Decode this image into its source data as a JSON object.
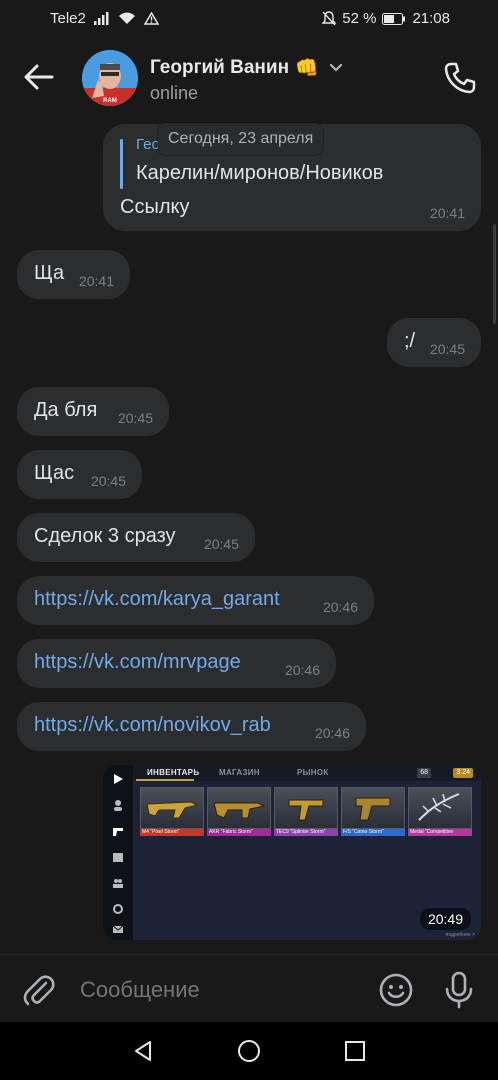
{
  "status_bar": {
    "carrier": "Tele2",
    "battery_percent": "52 %",
    "time": "21:08",
    "icons": [
      "signal-icon",
      "wifi-icon",
      "warning-icon",
      "mute-icon",
      "battery-icon"
    ]
  },
  "header": {
    "name": "Георгий Ванин",
    "emoji": "👊",
    "status": "online",
    "icons": [
      "back-arrow-icon",
      "chevron-down-icon",
      "phone-icon"
    ]
  },
  "date_divider": "Сегодня, 23 апреля",
  "reply_message": {
    "author": "Геор",
    "quoted_text": "Карелин/миронов/Новиков",
    "text": "Ссылку",
    "time": "20:41"
  },
  "messages": [
    {
      "side": "in",
      "text": "Ща",
      "time": "20:41",
      "is_link": false
    },
    {
      "side": "out",
      "text": ";/",
      "time": "20:45",
      "is_link": false
    },
    {
      "side": "in",
      "text": "Да бля",
      "time": "20:45",
      "is_link": false
    },
    {
      "side": "in",
      "text": "Щас",
      "time": "20:45",
      "is_link": false
    },
    {
      "side": "in",
      "text": "Сделок 3 сразу",
      "time": "20:45",
      "is_link": false
    },
    {
      "side": "in",
      "text": "https://vk.com/karya_garant",
      "time": "20:46",
      "is_link": true
    },
    {
      "side": "in",
      "text": "https://vk.com/mrvpage",
      "time": "20:46",
      "is_link": true
    },
    {
      "side": "in",
      "text": "https://vk.com/novikov_rab",
      "time": "20:46",
      "is_link": true
    }
  ],
  "image_message": {
    "time": "20:49",
    "tabs": [
      "ИНВЕНТАРЬ",
      "МАГАЗИН",
      "РЫНОК"
    ],
    "balance_1": "68",
    "balance_2": "3.24",
    "items": [
      {
        "name": "M4 \"Pixel Storm\"",
        "color": "#c0392b"
      },
      {
        "name": "AKR \"Fabric Storm\"",
        "color": "#a02a9a"
      },
      {
        "name": "TEC9 \"Splinter Storm\"",
        "color": "#8e44ad"
      },
      {
        "name": "F/S \"Camo Storm\"",
        "color": "#2e6bd1"
      },
      {
        "name": "Medal \"Competitive",
        "color": "#b03aa0"
      }
    ],
    "footer": "подробнее >"
  },
  "input": {
    "placeholder": "Сообщение",
    "icons": [
      "attach-icon",
      "emoji-icon",
      "mic-icon"
    ]
  },
  "nav_bar": {
    "icons": [
      "nav-back-icon",
      "nav-home-icon",
      "nav-recents-icon"
    ]
  },
  "colors": {
    "background": "#19191a",
    "bubble": "#2c2d2e",
    "link": "#71aaeb",
    "time_text": "#7d8085"
  }
}
